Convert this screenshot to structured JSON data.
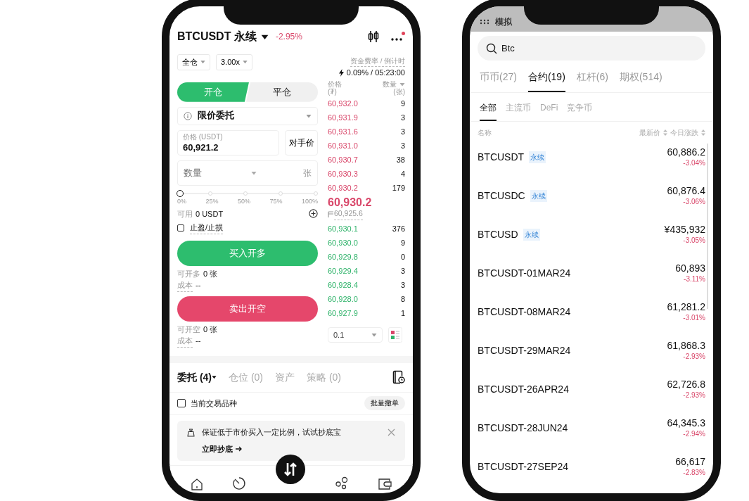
{
  "trade_screen": {
    "header": {
      "symbol": "BTCUSDT 永续",
      "change": "-2.95%",
      "has_notification": true
    },
    "margin_mode": "全仓",
    "leverage": "3.00x",
    "funding": {
      "label": "资金费率 / 倒计时",
      "value": "0.09% / 05:23:00"
    },
    "side_tabs": [
      {
        "label": "开仓",
        "selected": true
      },
      {
        "label": "平仓",
        "selected": false
      }
    ],
    "order_type": "限价委托",
    "price_field": {
      "label": "价格 (USDT)",
      "value": "60,921.2"
    },
    "counterparty_button": "对手价",
    "quantity_field": {
      "placeholder": "数量",
      "unit": "张"
    },
    "slider": {
      "level": 0,
      "ticks": [
        "0%",
        "25%",
        "50%",
        "75%",
        "100%"
      ]
    },
    "available": {
      "label": "可用",
      "value": "0 USDT"
    },
    "tp_sl": {
      "label": "止盈/止损",
      "checked": false
    },
    "actions": [
      {
        "kind": "buy",
        "button": "买入开多",
        "max_label": "可开多",
        "max_value": "0 张",
        "cost_label": "成本",
        "cost_value": "--"
      },
      {
        "kind": "sell",
        "button": "卖出开空",
        "max_label": "可开空",
        "max_value": "0 张",
        "cost_label": "成本",
        "cost_value": "--"
      }
    ],
    "order_book": {
      "price_header": "价格",
      "price_unit": "(₮)",
      "qty_header": "数量",
      "qty_unit": "(张)",
      "asks": [
        {
          "price": "60,932.0",
          "qty": "9"
        },
        {
          "price": "60,931.9",
          "qty": "3"
        },
        {
          "price": "60,931.6",
          "qty": "3"
        },
        {
          "price": "60,931.0",
          "qty": "3"
        },
        {
          "price": "60,930.7",
          "qty": "38"
        },
        {
          "price": "60,930.3",
          "qty": "4"
        },
        {
          "price": "60,930.2",
          "qty": "179"
        }
      ],
      "last_price": "60,930.2",
      "mark_price": "60,925.6",
      "bids": [
        {
          "price": "60,930.1",
          "qty": "376"
        },
        {
          "price": "60,930.0",
          "qty": "9"
        },
        {
          "price": "60,929.8",
          "qty": "0"
        },
        {
          "price": "60,929.4",
          "qty": "3"
        },
        {
          "price": "60,928.4",
          "qty": "3"
        },
        {
          "price": "60,928.0",
          "qty": "8"
        },
        {
          "price": "60,927.9",
          "qty": "1"
        }
      ],
      "depth": "0.1"
    },
    "bottom_tabs": [
      {
        "label": "委托 (4)",
        "selected": true
      },
      {
        "label": "仓位 (0)",
        "selected": false
      },
      {
        "label": "资产",
        "selected": false
      },
      {
        "label": "策略 (0)",
        "selected": false
      }
    ],
    "current_symbol_filter": {
      "label": "当前交易品种",
      "checked": false
    },
    "cancel_all_button": "批量撤单",
    "banner": {
      "text": "保证低于市价买入一定比例，试试抄底宝",
      "link": "立即抄底"
    }
  },
  "search_screen": {
    "status_text": "模拟",
    "search": {
      "value": "Btc"
    },
    "tabs": [
      {
        "label": "币币(27)",
        "selected": false
      },
      {
        "label": "合约(19)",
        "selected": true
      },
      {
        "label": "杠杆(6)",
        "selected": false
      },
      {
        "label": "期权(514)",
        "selected": false
      }
    ],
    "subtabs": [
      {
        "label": "全部",
        "selected": true
      },
      {
        "label": "主流币",
        "selected": false
      },
      {
        "label": "DeFi",
        "selected": false
      },
      {
        "label": "竞争币",
        "selected": false
      }
    ],
    "columns": {
      "name": "名称",
      "price": "最新价",
      "change": "今日涨跌"
    },
    "rows": [
      {
        "name": "BTCUSDT",
        "tag": "永续",
        "price": "60,886.2",
        "change": "-3.04%"
      },
      {
        "name": "BTCUSDC",
        "tag": "永续",
        "price": "60,876.4",
        "change": "-3.06%"
      },
      {
        "name": "BTCUSD",
        "tag": "永续",
        "price": "¥435,932",
        "change": "-3.05%"
      },
      {
        "name": "BTCUSDT-01MAR24",
        "price": "60,893",
        "change": "-3.11%"
      },
      {
        "name": "BTCUSDT-08MAR24",
        "price": "61,281.2",
        "change": "-3.01%"
      },
      {
        "name": "BTCUSDT-29MAR24",
        "price": "61,868.3",
        "change": "-2.93%"
      },
      {
        "name": "BTCUSDT-26APR24",
        "price": "62,726.8",
        "change": "-2.93%"
      },
      {
        "name": "BTCUSDT-28JUN24",
        "price": "64,345.3",
        "change": "-2.94%"
      },
      {
        "name": "BTCUSDT-27SEP24",
        "price": "66,617",
        "change": "-2.83%"
      }
    ]
  }
}
